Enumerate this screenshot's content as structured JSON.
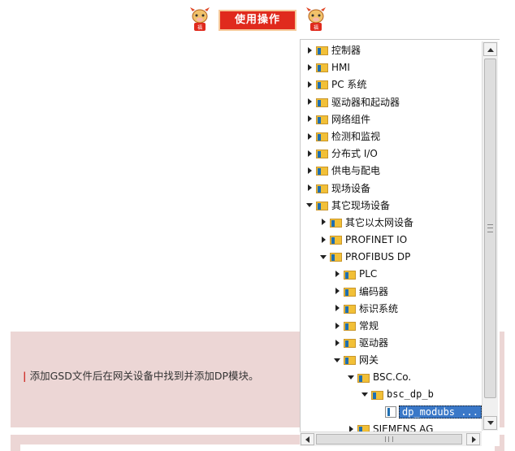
{
  "header": {
    "title": "使用操作"
  },
  "caption": {
    "marker": "|",
    "text": "添加GSD文件后在网关设备中找到并添加DP模块。"
  },
  "tree": {
    "items": [
      {
        "label": "控制器",
        "level": 0,
        "state": "collapsed",
        "icon": "folder-icon"
      },
      {
        "label": "HMI",
        "level": 0,
        "state": "collapsed",
        "icon": "folder-icon"
      },
      {
        "label": "PC 系统",
        "level": 0,
        "state": "collapsed",
        "icon": "folder-icon"
      },
      {
        "label": "驱动器和起动器",
        "level": 0,
        "state": "collapsed",
        "icon": "folder-icon"
      },
      {
        "label": "网络组件",
        "level": 0,
        "state": "collapsed",
        "icon": "folder-icon"
      },
      {
        "label": "检测和监视",
        "level": 0,
        "state": "collapsed",
        "icon": "folder-icon"
      },
      {
        "label": "分布式 I/O",
        "level": 0,
        "state": "collapsed",
        "icon": "folder-icon"
      },
      {
        "label": "供电与配电",
        "level": 0,
        "state": "collapsed",
        "icon": "folder-icon"
      },
      {
        "label": "现场设备",
        "level": 0,
        "state": "collapsed",
        "icon": "folder-icon"
      },
      {
        "label": "其它现场设备",
        "level": 0,
        "state": "expanded",
        "icon": "folder-icon"
      },
      {
        "label": "其它以太网设备",
        "level": 1,
        "state": "collapsed",
        "icon": "folder-icon"
      },
      {
        "label": "PROFINET IO",
        "level": 1,
        "state": "collapsed",
        "icon": "folder-icon"
      },
      {
        "label": "PROFIBUS DP",
        "level": 1,
        "state": "expanded",
        "icon": "folder-icon"
      },
      {
        "label": "PLC",
        "level": 2,
        "state": "collapsed",
        "icon": "folder-icon"
      },
      {
        "label": "编码器",
        "level": 2,
        "state": "collapsed",
        "icon": "folder-icon"
      },
      {
        "label": "标识系统",
        "level": 2,
        "state": "collapsed",
        "icon": "folder-icon"
      },
      {
        "label": "常规",
        "level": 2,
        "state": "collapsed",
        "icon": "folder-icon"
      },
      {
        "label": "驱动器",
        "level": 2,
        "state": "collapsed",
        "icon": "folder-icon"
      },
      {
        "label": "网关",
        "level": 2,
        "state": "expanded",
        "icon": "folder-icon"
      },
      {
        "label": "BSC.Co.",
        "level": 3,
        "state": "expanded",
        "icon": "folder-icon"
      },
      {
        "label": "bsc_dp_b",
        "level": 4,
        "state": "expanded",
        "icon": "folder-icon"
      },
      {
        "label": "dp_modubs ...",
        "level": 5,
        "state": "leaf",
        "icon": "device-icon",
        "selected": true
      },
      {
        "label": "SIEMENS AG",
        "level": 3,
        "state": "collapsed",
        "icon": "folder-icon"
      }
    ]
  }
}
